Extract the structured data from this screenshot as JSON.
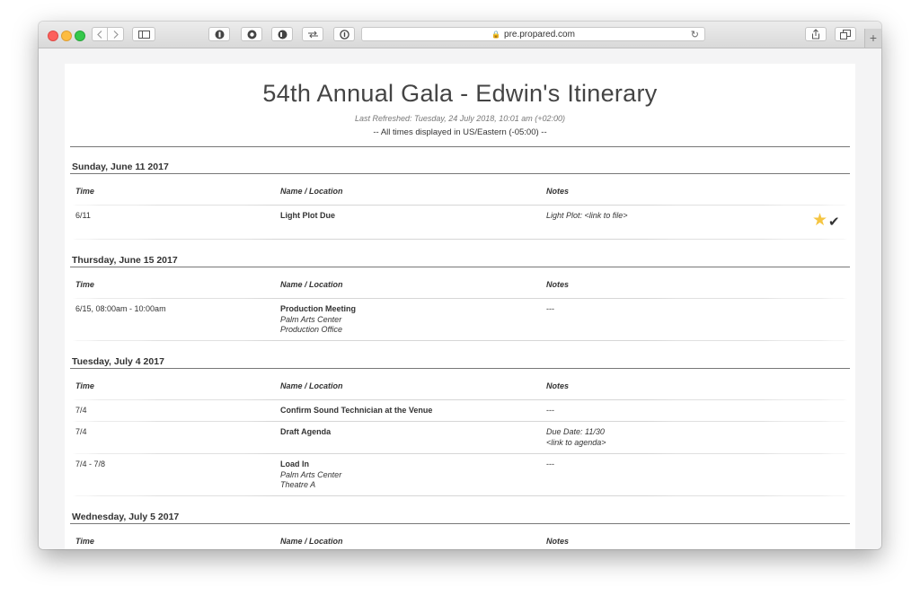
{
  "browser": {
    "url": "pre.propared.com"
  },
  "page": {
    "title": "54th Annual Gala - Edwin's Itinerary",
    "refreshed": "Last Refreshed: Tuesday, 24 July 2018, 10:01 am (+02:00)",
    "timezone_note": "-- All times displayed in US/Eastern (-05:00) --"
  },
  "columns": {
    "time": "Time",
    "name": "Name / Location",
    "notes": "Notes"
  },
  "days": [
    {
      "date": "Sunday, June 11 2017",
      "rows": [
        {
          "time": "6/11",
          "name": "Light Plot Due",
          "location": [],
          "notes": [
            "Light Plot: <link to file>"
          ],
          "starred": true,
          "checked": true
        }
      ]
    },
    {
      "date": "Thursday, June 15 2017",
      "rows": [
        {
          "time": "6/15, 08:00am - 10:00am",
          "name": "Production Meeting",
          "location": [
            "Palm Arts Center",
            "Production Office"
          ],
          "notes": [
            "---"
          ]
        }
      ]
    },
    {
      "date": "Tuesday, July 4 2017",
      "rows": [
        {
          "time": "7/4",
          "name": "Confirm Sound Technician at the Venue",
          "location": [],
          "notes": [
            "---"
          ]
        },
        {
          "time": "7/4",
          "name": "Draft Agenda",
          "location": [],
          "notes": [
            "Due Date: 11/30",
            "<link to agenda>"
          ]
        },
        {
          "time": "7/4 - 7/8",
          "name": "Load In",
          "location": [
            "Palm Arts Center",
            "Theatre A"
          ],
          "notes": [
            "---"
          ]
        }
      ]
    },
    {
      "date": "Wednesday, July 5 2017",
      "rows": []
    }
  ],
  "colors": {
    "star": "#f5c542"
  }
}
